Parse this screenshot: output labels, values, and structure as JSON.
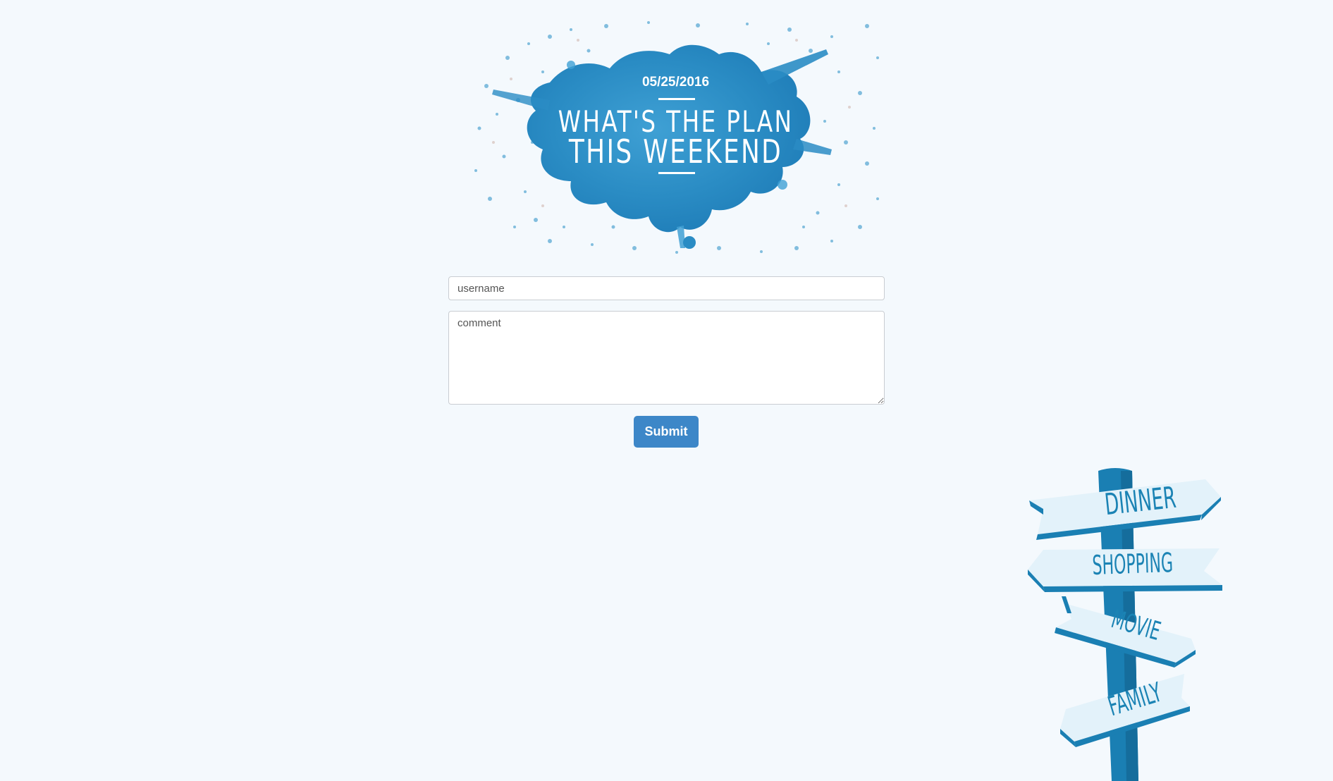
{
  "header": {
    "date": "05/25/2016",
    "title_line1": "WHAT'S THE PLAN",
    "title_line2": "THIS WEEKEND"
  },
  "form": {
    "username_placeholder": "username",
    "username_value": "",
    "comment_placeholder": "comment",
    "comment_value": "",
    "submit_label": "Submit"
  },
  "signpost": {
    "signs": [
      "DINNER",
      "SHOPPING",
      "MOVIE",
      "FAMILY"
    ]
  },
  "colors": {
    "background": "#f4f9fd",
    "accent": "#3d87c8",
    "watercolor": "#2d8fc6",
    "sign_text": "#1b83b4",
    "sign_face": "#e3f2fa"
  }
}
